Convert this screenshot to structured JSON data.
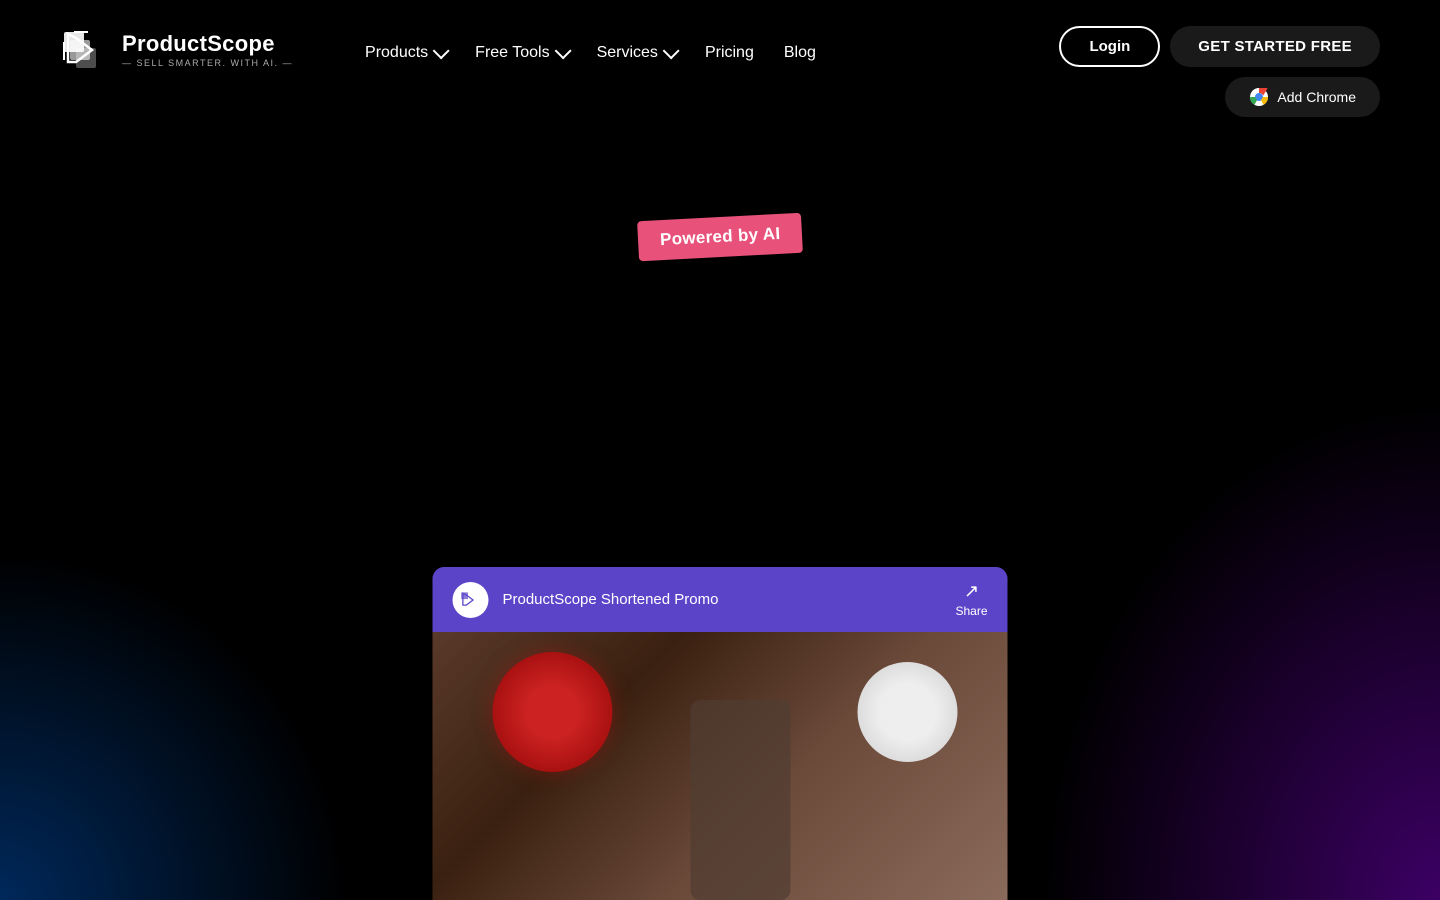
{
  "brand": {
    "name": "ProductScope",
    "tagline": "— SELL SMARTER. WITH AI. —"
  },
  "nav": {
    "items": [
      {
        "label": "Products",
        "has_dropdown": true
      },
      {
        "label": "Free Tools",
        "has_dropdown": true
      },
      {
        "label": "Services",
        "has_dropdown": true
      },
      {
        "label": "Pricing",
        "has_dropdown": false
      },
      {
        "label": "Blog",
        "has_dropdown": false
      }
    ],
    "login_label": "Login",
    "get_started_label": "GET STARTED FREE",
    "add_chrome_label": "Add Chrome"
  },
  "hero": {
    "badge_text": "Powered by AI"
  },
  "video": {
    "channel_name": "ProductScope Shortened Promo",
    "share_label": "Share"
  }
}
